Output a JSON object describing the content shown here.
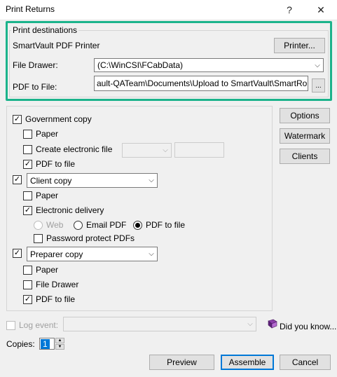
{
  "window": {
    "title": "Print Returns",
    "help_glyph": "?",
    "close_glyph": "✕"
  },
  "destinations": {
    "group_label": "Print destinations",
    "printer_name": "SmartVault PDF Printer",
    "printer_button": "Printer...",
    "file_drawer_label": "File Drawer:",
    "file_drawer_value": "(C:\\WinCSI\\FCabData)",
    "pdf_label": "PDF to File:",
    "pdf_path": "ault-QATeam\\Documents\\Upload to SmartVault\\SmartRouting\\",
    "browse_button": "..."
  },
  "side_buttons": {
    "options": "Options",
    "watermark": "Watermark",
    "clients": "Clients"
  },
  "government": {
    "label": "Government copy",
    "checked": true,
    "paper": "Paper",
    "create_electronic": "Create electronic file",
    "pdf_to_file": "PDF to file"
  },
  "client": {
    "combo_value": "Client copy",
    "paper": "Paper",
    "electronic_delivery": "Electronic delivery",
    "radio_web": "Web",
    "radio_email": "Email PDF",
    "radio_pdf": "PDF to file",
    "password_protect": "Password protect PDFs"
  },
  "preparer": {
    "combo_value": "Preparer copy",
    "paper": "Paper",
    "file_drawer": "File Drawer",
    "pdf_to_file": "PDF to file"
  },
  "log": {
    "label": "Log event:",
    "did_you_know": "Did you know..."
  },
  "copies": {
    "label": "Copies:",
    "value": "1"
  },
  "footer": {
    "preview": "Preview",
    "assemble": "Assemble",
    "cancel": "Cancel"
  },
  "colors": {
    "highlight": "#1bb38b",
    "accent": "#0078d7"
  },
  "icons": {
    "check": "✓",
    "dropdown": "chevron-down-icon",
    "book": "book-icon"
  }
}
